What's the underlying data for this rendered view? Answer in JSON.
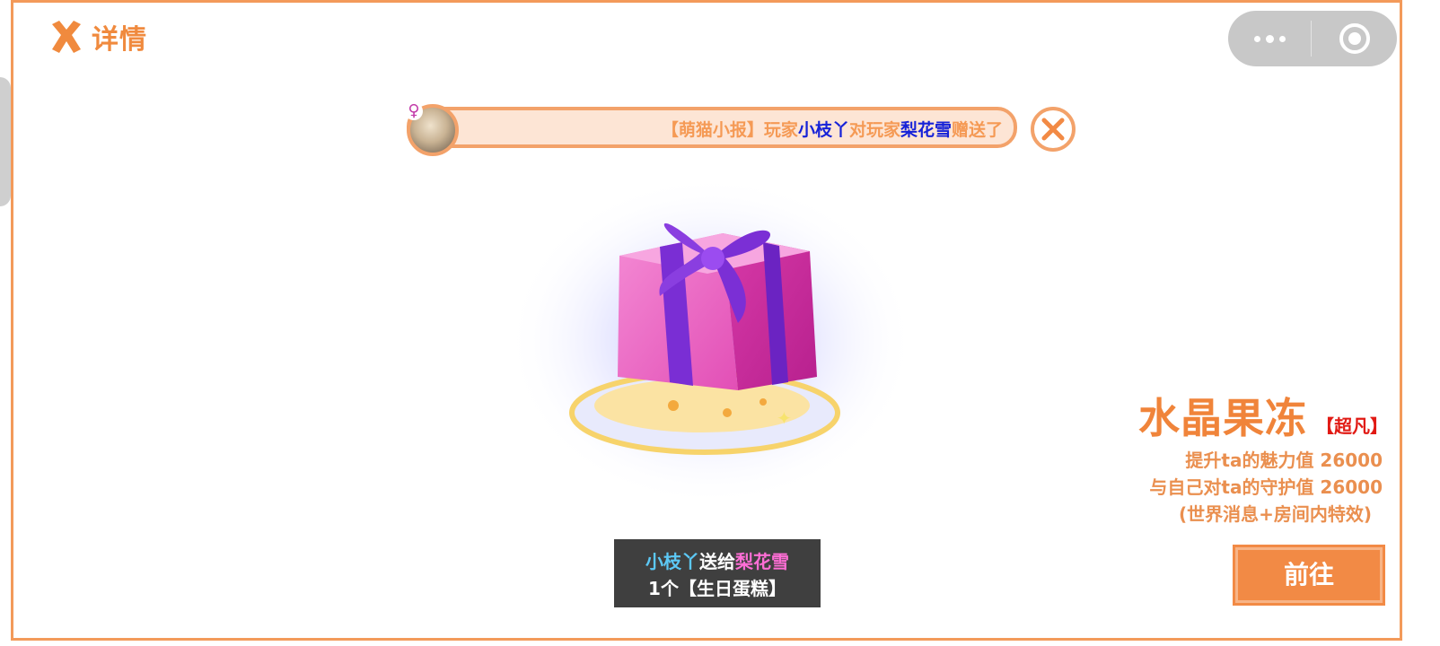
{
  "header": {
    "back_label": "详情",
    "back_icon": "close-x-icon",
    "capsule": {
      "more_icon": "more-dots-icon",
      "close_icon": "target-circle-icon"
    }
  },
  "marquee": {
    "prefix": "【萌猫小报】玩家",
    "sender": "小枝丫",
    "middle": "对玩家",
    "receiver": "梨花雪",
    "suffix": "赠送了",
    "gender_symbol": "♀",
    "close_icon": "circle-close-icon"
  },
  "toast": {
    "sender": "小枝丫",
    "verb": "送给",
    "receiver": "梨花雪",
    "line2": "1个【生日蛋糕】"
  },
  "gift": {
    "name": "水晶果冻",
    "rarity": "【超凡】",
    "desc_line1": "提升ta的魅力值 26000",
    "desc_line2": "与自己对ta的守护值 26000",
    "desc_line3": "(世界消息+房间内特效)",
    "go_label": "前往",
    "image_icon": "gift-box-icon"
  },
  "colors": {
    "accent": "#f08a3e",
    "border": "#f39a5a",
    "name_blue": "#1622d8",
    "rarity_red": "#e11a14",
    "toast_bg": "#3f3f3f"
  }
}
